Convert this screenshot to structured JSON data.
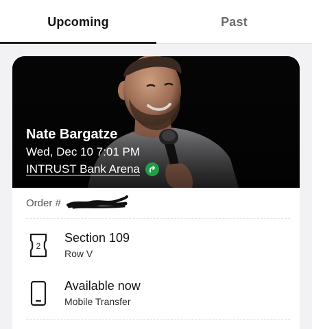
{
  "tabs": [
    {
      "label": "Upcoming",
      "active": true
    },
    {
      "label": "Past",
      "active": false
    }
  ],
  "event": {
    "name": "Nate Bargatze",
    "datetime": "Wed, Dec 10 7:01 PM",
    "venue": "INTRUST Bank Arena",
    "directions_icon": "directions-arrow-icon"
  },
  "order": {
    "label": "Order #",
    "number_redacted": true
  },
  "tickets": {
    "icon": "ticket-icon",
    "count": "2",
    "section": "Section 109",
    "row": "Row V"
  },
  "delivery": {
    "icon": "mobile-phone-icon",
    "status": "Available now",
    "method": "Mobile Transfer"
  },
  "colors": {
    "active_tab": "#111111",
    "inactive_tab": "#6c6c70",
    "directions_green": "#1f9e4a",
    "hero_background": "#050505"
  }
}
